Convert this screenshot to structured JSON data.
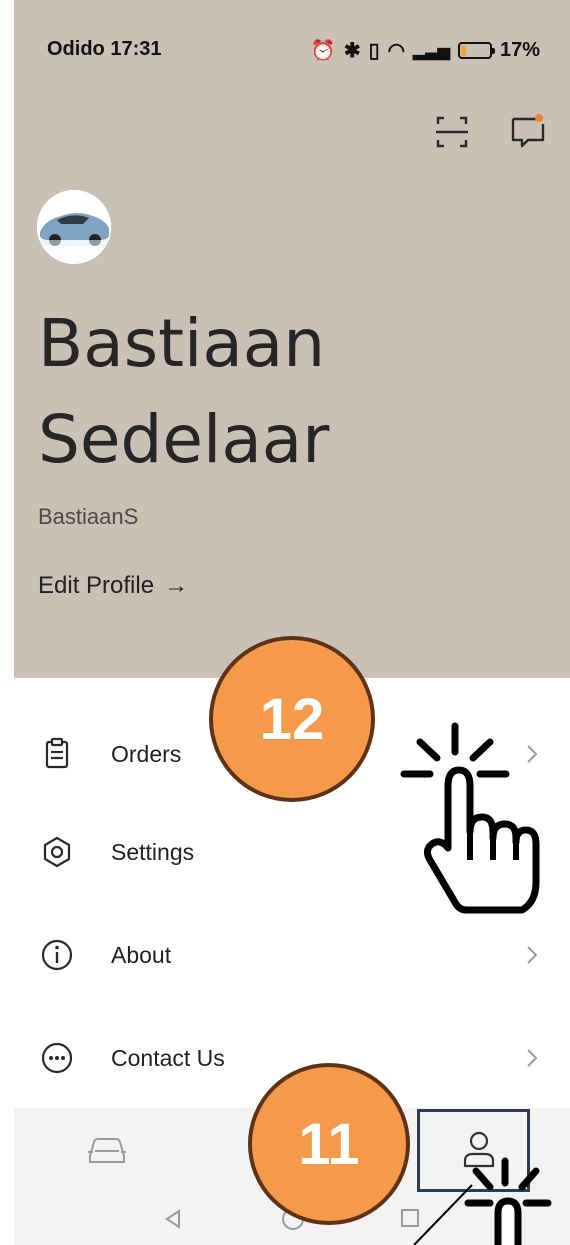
{
  "status_bar": {
    "carrier": "Odido",
    "time": "17:31",
    "battery": "17%"
  },
  "profile": {
    "name_line1": "Bastiaan",
    "name_line2": "Sedelaar",
    "username": "BastiaanS",
    "edit_label": "Edit Profile",
    "edit_arrow": "→"
  },
  "menu": [
    {
      "label": "Orders",
      "icon": "clipboard-icon"
    },
    {
      "label": "Settings",
      "icon": "hexagon-settings-icon"
    },
    {
      "label": "About",
      "icon": "info-icon"
    },
    {
      "label": "Contact Us",
      "icon": "chat-dots-icon"
    }
  ],
  "bottom_nav": [
    {
      "icon": "car-icon"
    },
    {
      "icon": "profile-icon"
    }
  ],
  "annotations": {
    "step_a": "12",
    "step_b": "11"
  },
  "colors": {
    "header_bg": "#cbc0b5",
    "badge_fill": "#f49a4a",
    "badge_border": "#5e3216",
    "highlight_box": "#2d3e52",
    "notification_dot": "#f07f2f"
  }
}
